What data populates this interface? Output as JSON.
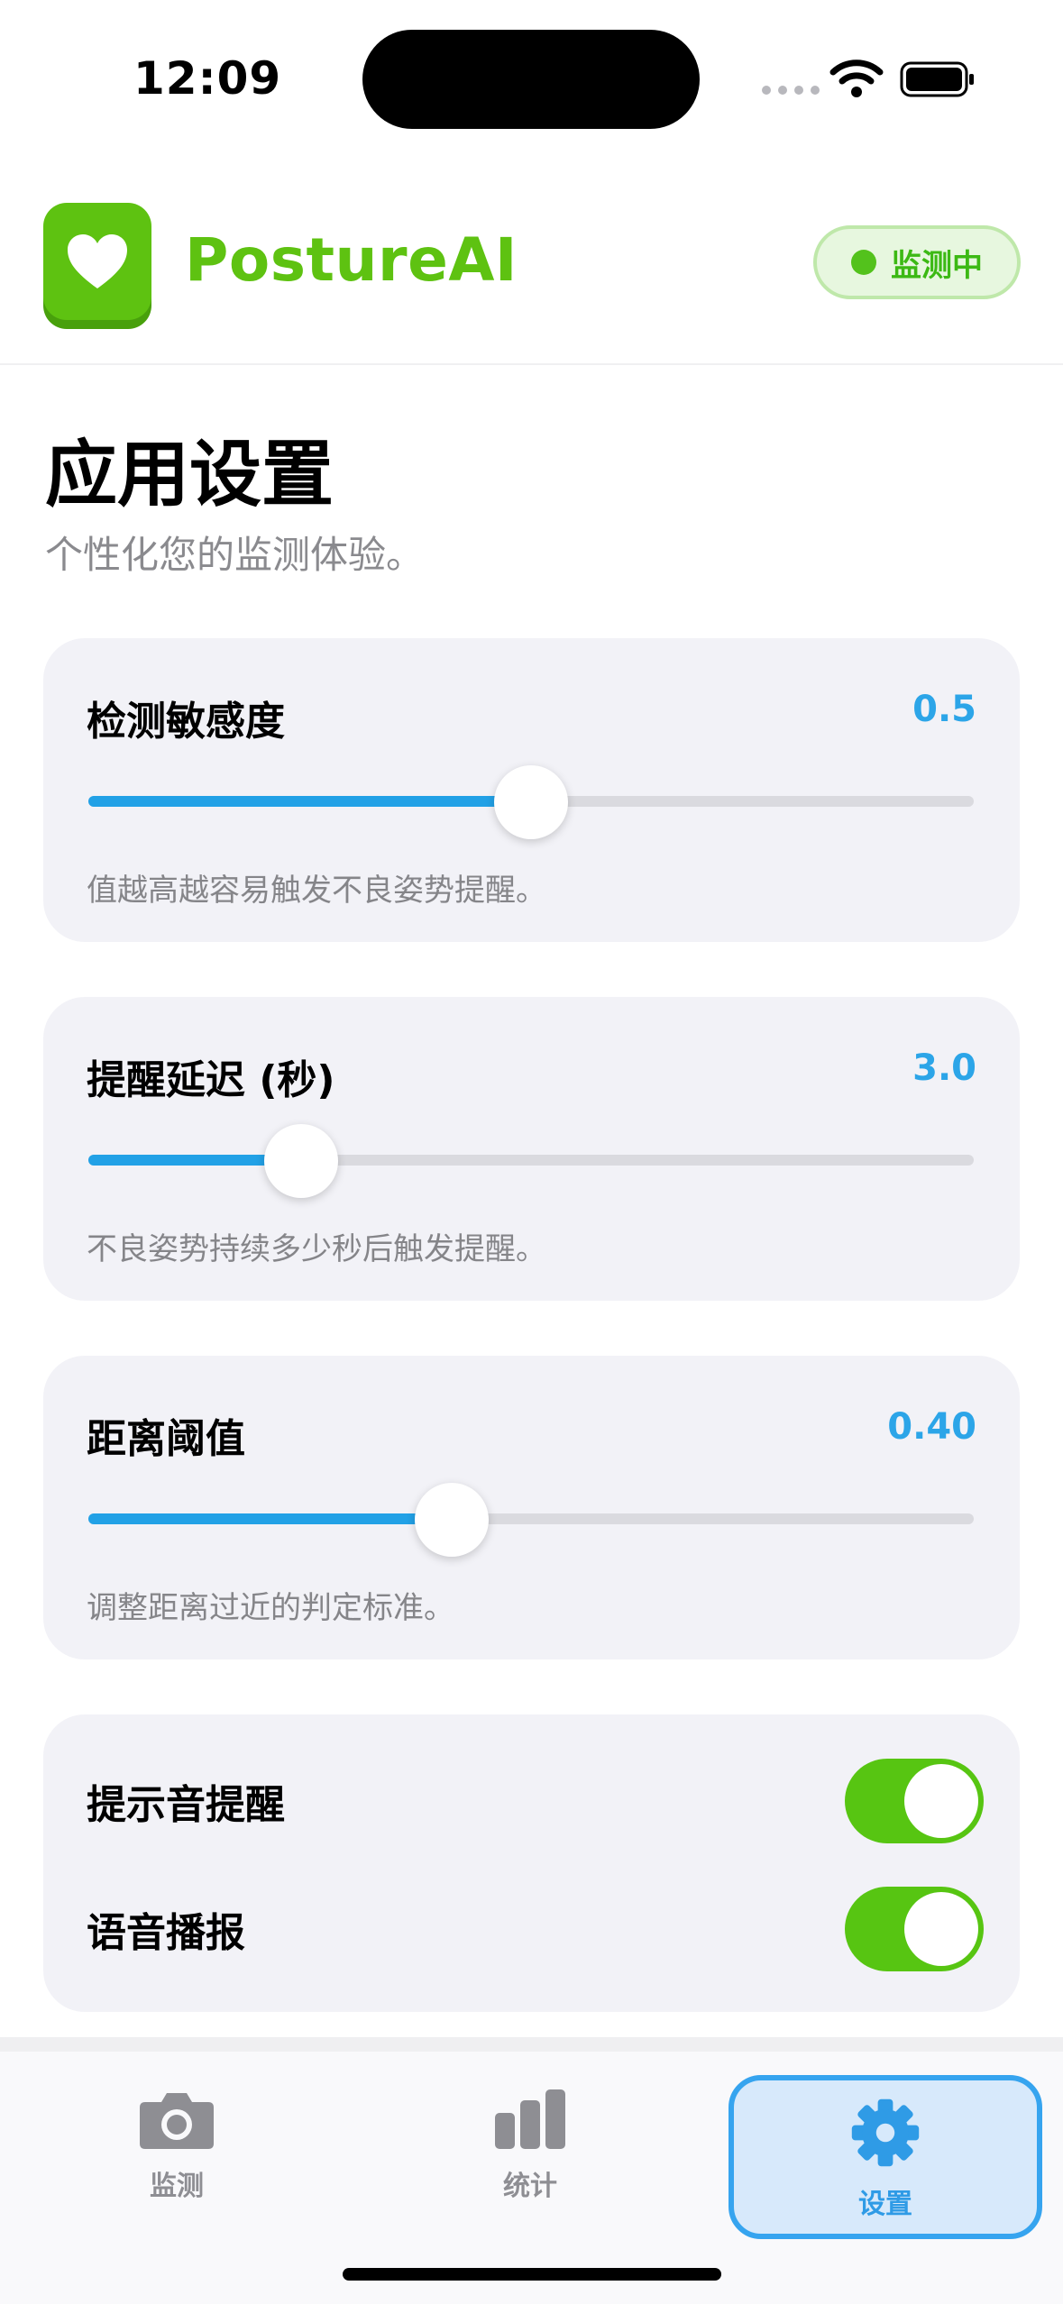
{
  "status_bar": {
    "time": "12:09"
  },
  "header": {
    "app_name": "PostureAI",
    "status_badge": "监测中",
    "colors": {
      "brand_green": "#5ec211",
      "accent_blue": "#2ca5e8"
    }
  },
  "page": {
    "title": "应用设置",
    "subtitle": "个性化您的监测体验。"
  },
  "settings": {
    "sensitivity": {
      "label": "检测敏感度",
      "value": "0.5",
      "fill_fraction": 0.5,
      "hint": "值越高越容易触发不良姿势提醒。"
    },
    "alert_delay": {
      "label": "提醒延迟 (秒)",
      "value": "3.0",
      "fill_fraction": 0.24,
      "hint": "不良姿势持续多少秒后触发提醒。"
    },
    "distance_threshold": {
      "label": "距离阈值",
      "value": "0.40",
      "fill_fraction": 0.41,
      "hint": "调整距离过近的判定标准。"
    },
    "sound_alert": {
      "label": "提示音提醒",
      "enabled": true
    },
    "voice_broadcast": {
      "label": "语音播报",
      "enabled": true
    }
  },
  "tabbar": {
    "tabs": [
      {
        "label": "监测",
        "icon": "camera-icon",
        "active": false
      },
      {
        "label": "统计",
        "icon": "bar-chart-icon",
        "active": false
      },
      {
        "label": "设置",
        "icon": "gear-icon",
        "active": true
      }
    ]
  }
}
